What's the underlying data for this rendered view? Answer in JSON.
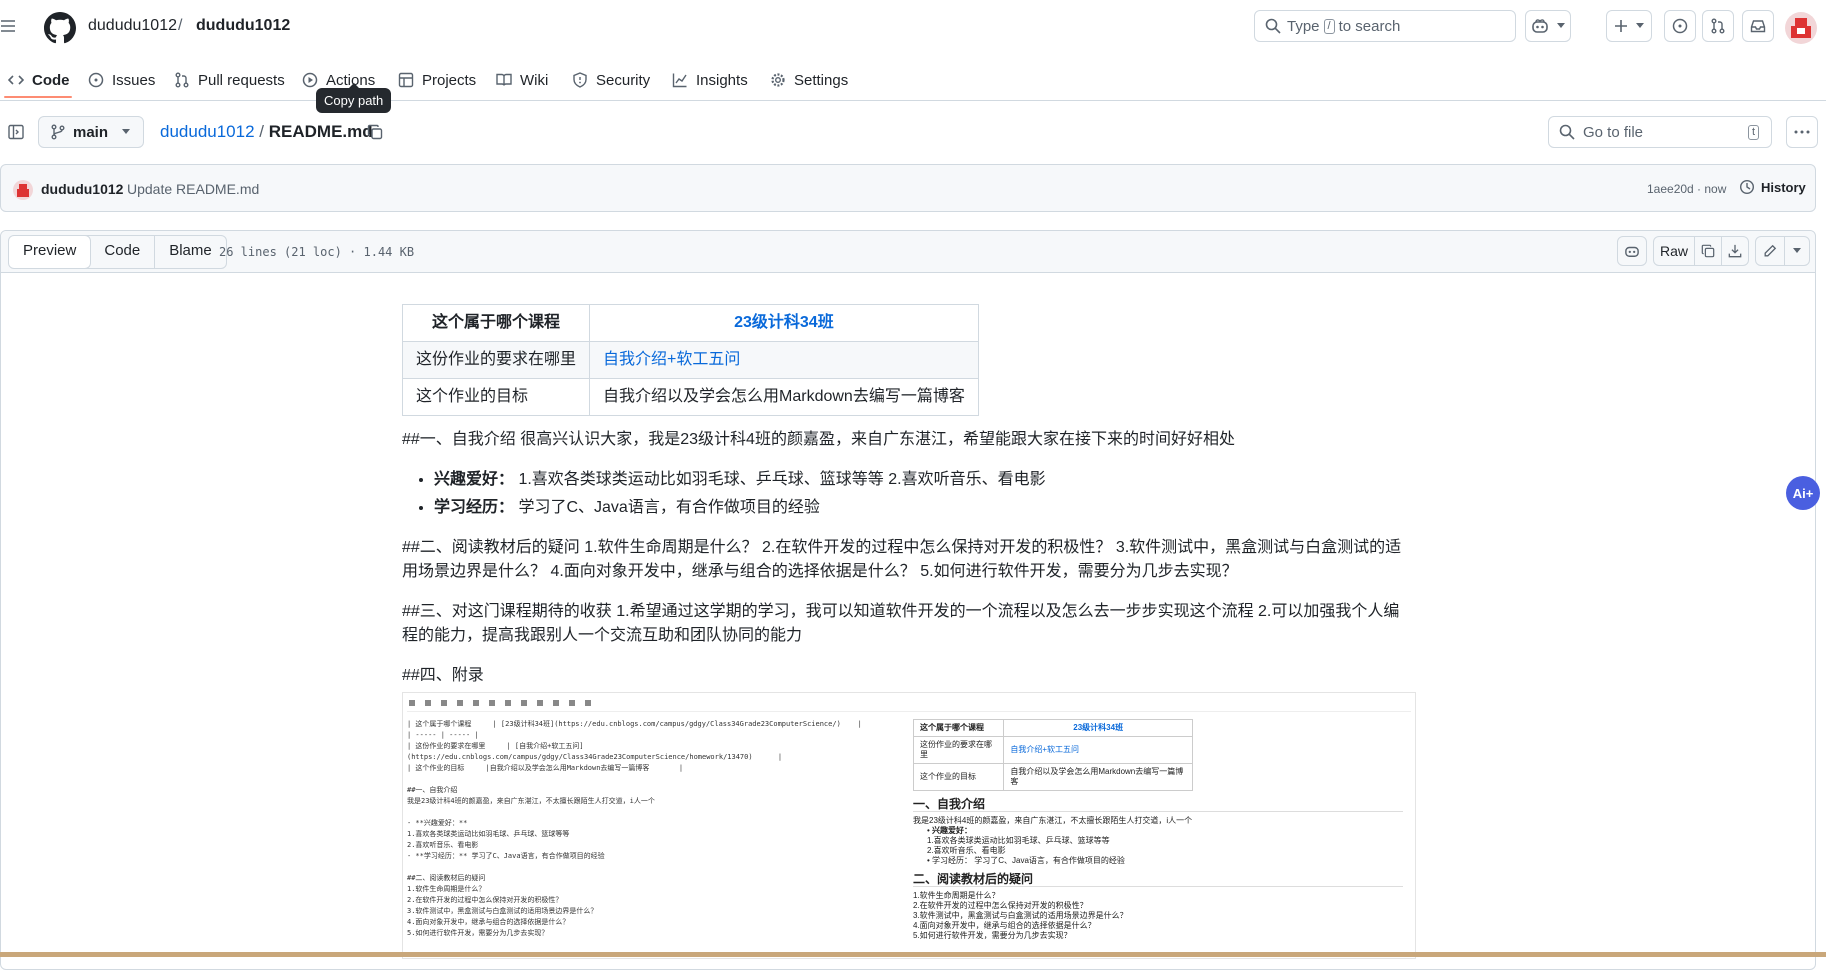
{
  "header": {
    "owner": "dududu1012",
    "repo": "dududu1012",
    "search_label_pre": "Type",
    "search_key": "/",
    "search_label_post": "to search"
  },
  "tabs": [
    {
      "label": "Code",
      "active": true
    },
    {
      "label": "Issues"
    },
    {
      "label": "Pull requests"
    },
    {
      "label": "Actions"
    },
    {
      "label": "Projects"
    },
    {
      "label": "Wiki"
    },
    {
      "label": "Security"
    },
    {
      "label": "Insights"
    },
    {
      "label": "Settings"
    }
  ],
  "tooltip": "Copy path",
  "file": {
    "branch": "main",
    "path_repo": "dududu1012",
    "path_sep": "/",
    "path_file": "README.md",
    "goto_placeholder": "Go to file",
    "goto_key": "t"
  },
  "commit": {
    "author": "dududu1012",
    "message": "Update README.md",
    "sha_time": "1aee20d · now",
    "history": "History"
  },
  "viewer": {
    "modes": [
      "Preview",
      "Code",
      "Blame"
    ],
    "meta": "26 lines (21 loc) · 1.44 KB",
    "raw": "Raw"
  },
  "readme": {
    "table": [
      [
        "这个属于哪个课程",
        "23级计科34班"
      ],
      [
        "这份作业的要求在哪里",
        "自我介绍+软工五问"
      ],
      [
        "这个作业的目标",
        "自我介绍以及学会怎么用Markdown去编写一篇博客"
      ]
    ],
    "p1": "##一、自我介绍 很高兴认识大家，我是23级计科4班的颜嘉盈，来自广东湛江，希望能跟大家在接下来的时间好好相处",
    "li1_bold": "兴趣爱好：",
    "li1_text": " 1.喜欢各类球类运动比如羽毛球、乒乓球、篮球等等 2.喜欢听音乐、看电影",
    "li2_bold": "学习经历：",
    "li2_text": " 学习了C、Java语言，有合作做项目的经验",
    "p2": "##二、阅读教材后的疑问 1.软件生命周期是什么？ 2.在软件开发的过程中怎么保持对开发的积极性？ 3.软件测试中，黑盒测试与白盒测试的适用场景边界是什么？ 4.面向对象开发中，继承与组合的选择依据是什么？ 5.如何进行软件开发，需要分为几步去实现？",
    "p3": "##三、对这门课程期待的收获 1.希望通过这学期的学习，我可以知道软件开发的一个流程以及怎么去一步步实现这个流程 2.可以加强我个人编程的能力，提高我跟别人一个交流互助和团队协同的能力",
    "p4": "##四、附录"
  },
  "screenshot": {
    "left_lines": "| 这个属于哪个课程     | [23级计科34班](https://edu.cnblogs.com/campus/gdgy/Class34Grade23ComputerScience/)    |\n| ----- | ----- |\n| 这份作业的要求在哪里     | [自我介绍+软工五问]\n(https://edu.cnblogs.com/campus/gdgy/Class34Grade23ComputerScience/homework/13470)      |\n| 这个作业的目标     |自我介绍以及学会怎么用Markdown去编写一篇博客       |\n\n##一、自我介绍\n我是23级计科4班的颜嘉盈，来自广东湛江，不太擅长跟陌生人打交道，i人一个\n\n- **兴趣爱好：**\n1.喜欢各类球类运动比如羽毛球、乒乓球、篮球等等\n2.喜欢听音乐、看电影\n- **学习经历：** 学习了C、Java语言，有合作做项目的经验\n\n##二、阅读教材后的疑问\n1.软件生命周期是什么？\n2.在软件开发的过程中怎么保持对开发的积极性？\n3.软件测试中，黑盒测试与白盒测试的适用场景边界是什么？\n4.面向对象开发中，继承与组合的选择依据是什么？\n5.如何进行软件开发，需要分为几步去实现？",
    "table": [
      [
        "这个属于哪个课程",
        "23级计科34班"
      ],
      [
        "这份作业的要求在哪里",
        "自我介绍+软工五问"
      ],
      [
        "这个作业的目标",
        "自我介绍以及学会怎么用Markdown去编写一篇博客"
      ]
    ],
    "h_intro": "一、自我介绍",
    "intro": "我是23级计科4班的颜嘉盈，来自广东湛江，不太擅长跟陌生人打交道，i人一个",
    "li_a": "兴趣爱好：",
    "li_a1": "1.喜欢各类球类运动比如羽毛球、乒乓球、篮球等等",
    "li_a2": "2.喜欢听音乐、看电影",
    "li_b": "学习经历： 学习了C、Java语言，有合作做项目的经验",
    "h_q": "二、阅读教材后的疑问",
    "q1": "1.软件生命周期是什么？",
    "q2": "2.在软件开发的过程中怎么保持对开发的积极性？",
    "q3": "3.软件测试中，黑盒测试与白盒测试的适用场景边界是什么？",
    "q4": "4.面向对象开发中，继承与组合的选择依据是什么？",
    "q5": "5.如何进行软件开发，需要分为几步去实现？"
  },
  "ai_button": "Ai+"
}
